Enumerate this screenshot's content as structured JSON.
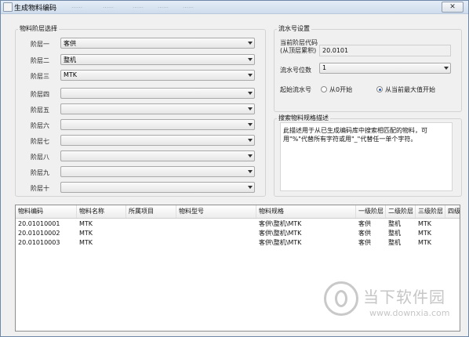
{
  "window": {
    "title": "生成物料编码",
    "close_label": "✕"
  },
  "title_fragments": [
    "……",
    "……",
    "……",
    "……",
    "……"
  ],
  "level_group": {
    "title": "物料阶层选择",
    "rows": [
      {
        "label": "阶层一",
        "value": "客供"
      },
      {
        "label": "阶层二",
        "value": "整机"
      },
      {
        "label": "阶层三",
        "value": "MTK"
      },
      {
        "label": "阶层四",
        "value": ""
      },
      {
        "label": "阶层五",
        "value": ""
      },
      {
        "label": "阶层六",
        "value": ""
      },
      {
        "label": "阶层七",
        "value": ""
      },
      {
        "label": "阶层八",
        "value": ""
      },
      {
        "label": "阶层九",
        "value": ""
      },
      {
        "label": "阶层十",
        "value": ""
      }
    ]
  },
  "serial_group": {
    "title": "流水号设置",
    "current_code_label": "当前阶层代码",
    "current_code_sublabel": "(从顶层累积)",
    "current_code_value": "20.0101",
    "digits_label": "流水号位数",
    "digits_value": "1",
    "start_label": "起始流水号",
    "option_zero": "从0开始",
    "option_max": "从当前最大值开始",
    "selected": "max"
  },
  "search_group": {
    "title": "搜索物料规格描述",
    "description": "此描述用于从已生成编码库中搜索相匹配的物料，可用\"%\"代替所有字符或用\"_\"代替任一单个字符。"
  },
  "table": {
    "columns": [
      "物料编码",
      "物料名称",
      "所属项目",
      "物料型号",
      "物料规格",
      "一级阶层",
      "二级阶层",
      "三级阶层",
      "四级"
    ],
    "rows": [
      [
        "20.01010001",
        "MTK",
        "",
        "",
        "客供\\整机\\MTK",
        "客供",
        "整机",
        "MTK",
        ""
      ],
      [
        "20.01010002",
        "MTK",
        "",
        "",
        "客供\\整机\\MTK",
        "客供",
        "整机",
        "MTK",
        ""
      ],
      [
        "20.01010003",
        "MTK",
        "",
        "",
        "客供\\整机\\MTK",
        "客供",
        "整机",
        "MTK",
        ""
      ]
    ]
  },
  "watermark": {
    "text": "当下软件园",
    "url": "www.downxia.com"
  }
}
